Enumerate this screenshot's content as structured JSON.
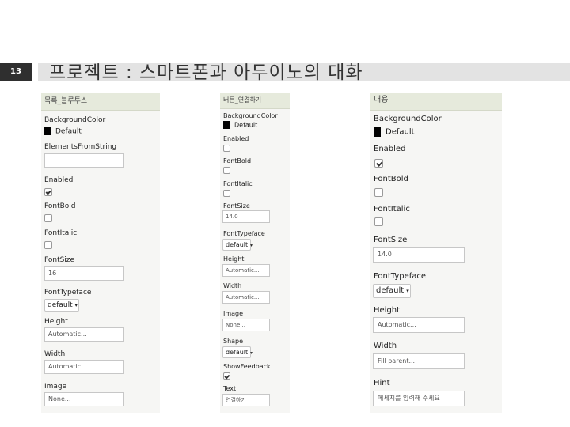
{
  "slide": {
    "number": "13",
    "title": "프로젝트 : 스마트폰과 아두이노의 대화"
  },
  "panels": {
    "p1": {
      "header": "목록_블루투스",
      "bg_label": "BackgroundColor",
      "bg_value": "Default",
      "elements_label": "ElementsFromString",
      "elements_value": "",
      "enabled_label": "Enabled",
      "fontbold_label": "FontBold",
      "fontitalic_label": "FontItalic",
      "fontsize_label": "FontSize",
      "fontsize_value": "16",
      "typeface_label": "FontTypeface",
      "typeface_value": "default",
      "height_label": "Height",
      "height_value": "Automatic...",
      "width_label": "Width",
      "width_value": "Automatic...",
      "image_label": "Image",
      "image_value": "None..."
    },
    "p2": {
      "header": "버튼_연결하기",
      "bg_label": "BackgroundColor",
      "bg_value": "Default",
      "enabled_label": "Enabled",
      "fontbold_label": "FontBold",
      "fontitalic_label": "FontItalic",
      "fontsize_label": "FontSize",
      "fontsize_value": "14.0",
      "typeface_label": "FontTypeface",
      "typeface_value": "default",
      "height_label": "Height",
      "height_value": "Automatic...",
      "width_label": "Width",
      "width_value": "Automatic...",
      "image_label": "Image",
      "image_value": "None...",
      "shape_label": "Shape",
      "shape_value": "default",
      "feedback_label": "ShowFeedback",
      "text_label": "Text",
      "text_value": "연결하기"
    },
    "p3": {
      "header": "내용",
      "bg_label": "BackgroundColor",
      "bg_value": "Default",
      "enabled_label": "Enabled",
      "fontbold_label": "FontBold",
      "fontitalic_label": "FontItalic",
      "fontsize_label": "FontSize",
      "fontsize_value": "14.0",
      "typeface_label": "FontTypeface",
      "typeface_value": "default",
      "height_label": "Height",
      "height_value": "Automatic...",
      "width_label": "Width",
      "width_value": "Fill parent...",
      "hint_label": "Hint",
      "hint_value": "메세지를 입력해 주세요"
    }
  },
  "colors": {
    "slide_num_bg": "#2f2f2f",
    "title_bar": "#e3e3e3",
    "panel_header": "#e6eadc",
    "panel_body": "#f6f6f4"
  }
}
